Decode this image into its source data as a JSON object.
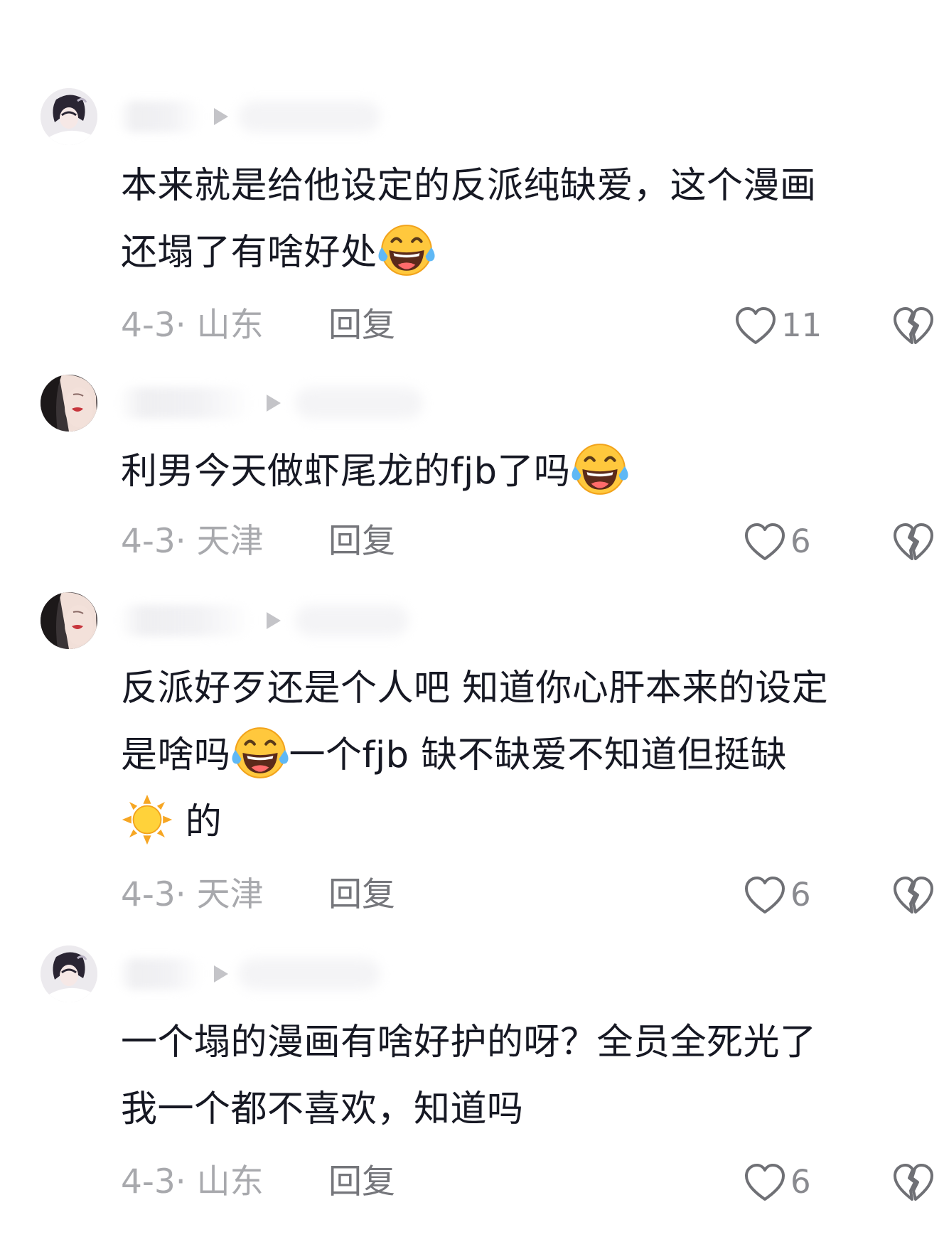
{
  "comments": [
    {
      "avatar": "avatar-anime-girl",
      "text_lines": [
        "本来就是给他设定的反派纯缺爱，这个漫画",
        "还塌了有啥好处"
      ],
      "emojis": [
        "laughing-crying-emoji"
      ],
      "date": "4-3",
      "sep": "·",
      "location": "山东",
      "reply_label": "回复",
      "likes": "11"
    },
    {
      "avatar": "avatar-photo-woman",
      "text_lines": [
        "利男今天做虾尾龙的fjb了吗"
      ],
      "emojis": [
        "laughing-crying-emoji"
      ],
      "date": "4-3",
      "sep": "·",
      "location": "天津",
      "reply_label": "回复",
      "likes": "6"
    },
    {
      "avatar": "avatar-photo-woman",
      "text_lines": [
        "反派好歹还是个人吧 知道你心肝本来的设定",
        "是啥吗",
        "一个fjb 缺不缺爱不知道但挺缺",
        "的"
      ],
      "emojis": [
        "laughing-crying-emoji",
        "sun-emoji"
      ],
      "date": "4-3",
      "sep": "·",
      "location": "天津",
      "reply_label": "回复",
      "likes": "6"
    },
    {
      "avatar": "avatar-anime-girl",
      "text_lines": [
        "一个塌的漫画有啥好护的呀？全员全死光了",
        "我一个都不喜欢，知道吗"
      ],
      "emojis": [],
      "date": "4-3",
      "sep": "·",
      "location": "山东",
      "reply_label": "回复",
      "likes": "6"
    }
  ],
  "colors": {
    "text": "#161823",
    "meta": "#a8a9ad",
    "reply": "#75767b",
    "icon": "#6f7075"
  }
}
